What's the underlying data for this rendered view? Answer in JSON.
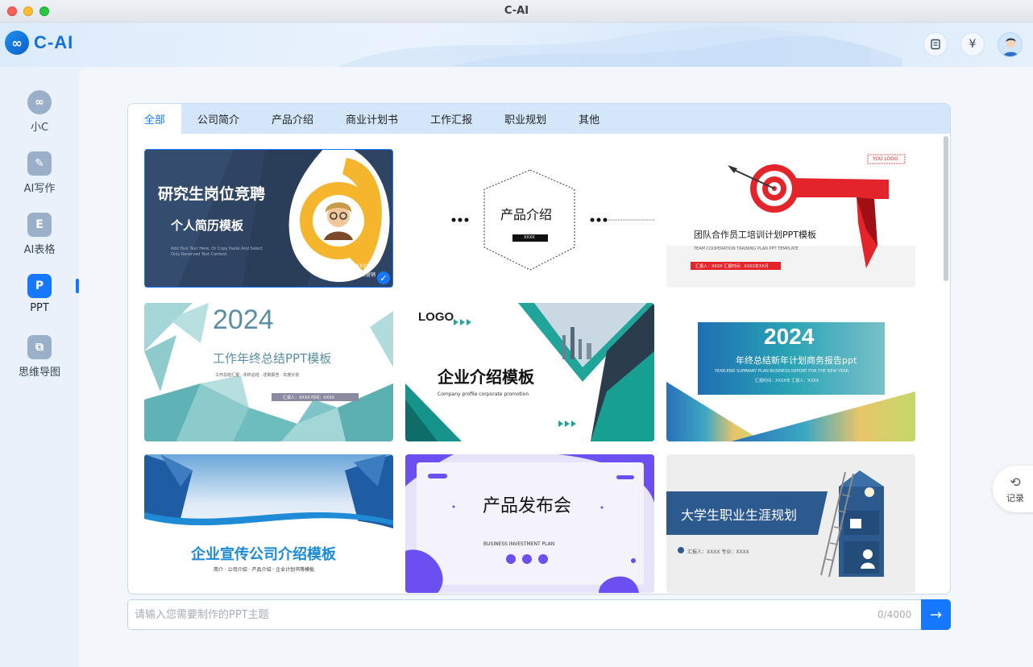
{
  "window": {
    "title": "C-AI"
  },
  "app": {
    "logo_text": "C-AI"
  },
  "header": {
    "book_icon": "book-icon",
    "yuan_symbol": "¥"
  },
  "sidebar": {
    "items": [
      {
        "label": "小C",
        "icon": "infinity-icon",
        "glyph": "∞"
      },
      {
        "label": "AI写作",
        "icon": "pen-icon",
        "glyph": "✎"
      },
      {
        "label": "AI表格",
        "icon": "sheet-icon",
        "glyph": "E"
      },
      {
        "label": "PPT",
        "icon": "ppt-icon",
        "glyph": "P"
      },
      {
        "label": "思维导图",
        "icon": "mindmap-icon",
        "glyph": "⧉"
      }
    ],
    "active": "PPT"
  },
  "tabs": [
    "全部",
    "公司简介",
    "产品介绍",
    "商业计划书",
    "工作汇报",
    "职业规划",
    "其他"
  ],
  "active_tab": "全部",
  "templates": [
    {
      "title": "研究生岗位竞聘",
      "subtitle": "个人简历模板",
      "text": "Add Your Text Here, Or Copy Paste And Select Only Reserved Text Content",
      "line1": "汇报：XXXX",
      "line2": "专业：市场营销",
      "selected": true
    },
    {
      "title": "产品介绍",
      "tag": "XXXX"
    },
    {
      "title": "团队合作员工培训计划PPT模板",
      "badge": "YOU LOGO",
      "subtitle": "TEAM COOPERATION TRAINING PLAN PPT TEMPLATE",
      "bar_text": "汇报人：XXXX  汇报时间：XXXX年XX月"
    },
    {
      "year": "2024",
      "title": "工作年终总结PPT模板",
      "subtitle": "工作总结汇报 · 年终总结 · 述职报告 · 年度计划",
      "bar_text": "汇报人：XXXX  时间：XXXX"
    },
    {
      "logo": "LOGO",
      "title": "企业介绍模板",
      "subtitle": "Company profile corporate promotion"
    },
    {
      "year": "2024",
      "title": "年终总结新年计划商务报告ppt",
      "subtitle": "YEAR-END SUMMARY PLAN BUSINESS REPORT FOR THE NEW YEAR",
      "line": "汇报时间：XXXX年  汇报人：XXXX"
    },
    {
      "title": "企业宣传公司介绍模板",
      "subtitle": "简介 · 公司介绍 · 产品介绍 · 企业计划书等模板"
    },
    {
      "title": "产品发布会",
      "subtitle": "BUSINESS INVESTMENT PLAN"
    },
    {
      "title": "大学生职业生涯规划",
      "subtitle": "汇报人：XXXX  专业：XXXX"
    }
  ],
  "prompt": {
    "placeholder": "请输入您需要制作的PPT主题",
    "counter": "0/4000"
  },
  "history": {
    "label": "记录"
  }
}
